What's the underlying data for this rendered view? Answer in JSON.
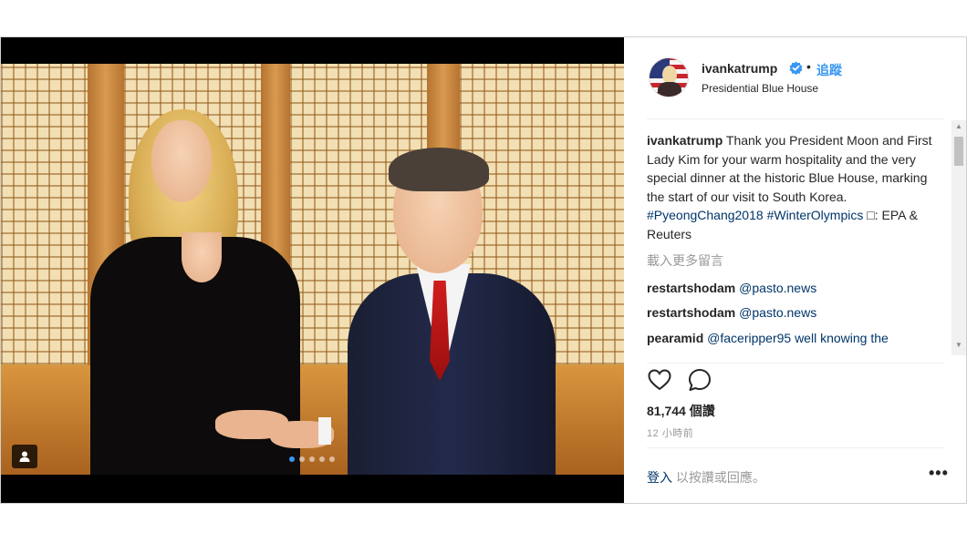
{
  "post": {
    "media": {
      "carousel": {
        "total": 5,
        "active": 1
      }
    },
    "header": {
      "username": "ivankatrump",
      "separator": "•",
      "follow_label": "追蹤",
      "location": "Presidential Blue House"
    },
    "caption": {
      "username": "ivankatrump",
      "text": " Thank you President Moon and First Lady Kim for your warm hospitality and the very special dinner at the historic Blue House, marking the start of our visit to South Korea. ",
      "hashtags": [
        "#PyeongChang2018",
        "#WinterOlympics"
      ],
      "credit": " □: EPA & Reuters"
    },
    "load_more_label": "載入更多留言",
    "comments": [
      {
        "username": "restartshodam",
        "text": "@pasto.news"
      },
      {
        "username": "restartshodam",
        "text": "@pasto.news"
      },
      {
        "username": "pearamid",
        "text": "@faceripper95 well knowing the"
      }
    ],
    "stats": {
      "views": "81,744 個讚",
      "time": "12 小時前"
    },
    "footer": {
      "login_link": "登入",
      "login_text": " 以按讚或回應。",
      "more_label": "•••"
    }
  },
  "colors": {
    "link_blue": "#3897f0",
    "dark_link": "#003569",
    "muted": "#999999"
  },
  "icons": {
    "verified": "verified-badge-icon",
    "like": "heart-outline-icon",
    "comment": "speech-bubble-icon",
    "user_tag": "user-tag-icon"
  }
}
